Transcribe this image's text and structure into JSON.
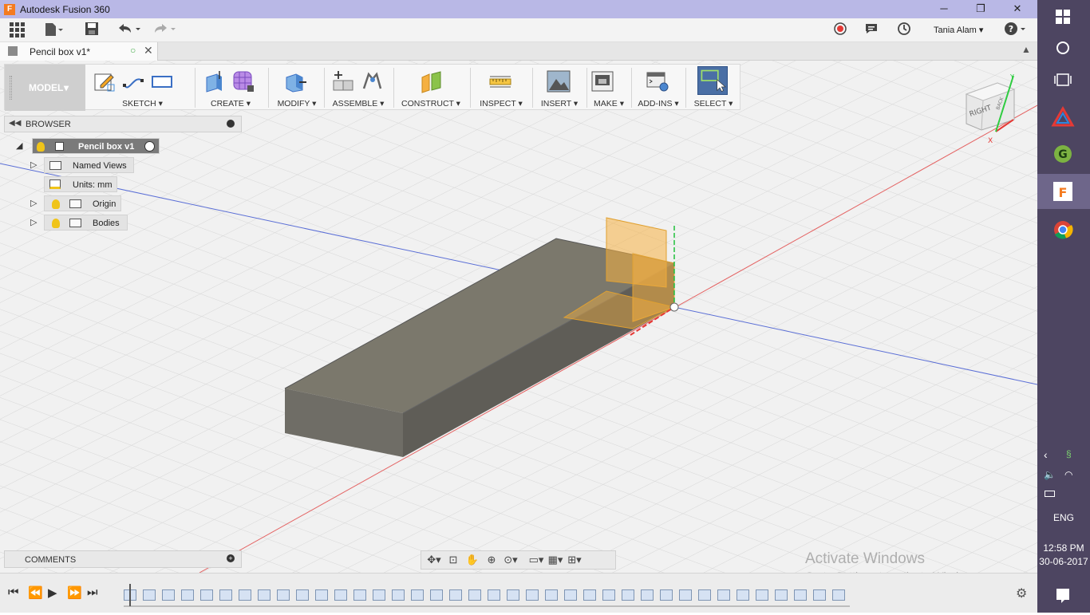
{
  "window": {
    "title": "Autodesk Fusion 360",
    "app_icon_letter": "F"
  },
  "toolbar": {
    "user": "Tania Alam"
  },
  "tab": {
    "name": "Pencil box v1*"
  },
  "ribbon": {
    "workspace": "MODEL",
    "groups": [
      "SKETCH",
      "CREATE",
      "MODIFY",
      "ASSEMBLE",
      "CONSTRUCT",
      "INSPECT",
      "INSERT",
      "MAKE",
      "ADD-INS",
      "SELECT"
    ]
  },
  "browser": {
    "header": "BROWSER",
    "root": "Pencil box v1",
    "items": [
      "Named Views",
      "Units: mm",
      "Origin",
      "Bodies"
    ]
  },
  "comments": {
    "label": "COMMENTS"
  },
  "viewcube": {
    "face_right": "RIGHT",
    "face_back": "BACK",
    "axis_x": "X",
    "axis_y": "Y"
  },
  "watermark": {
    "title": "Activate Windows",
    "subtitle": "Go to Settings to activate Windows."
  },
  "taskbar": {
    "language": "ENG",
    "time": "12:58 PM",
    "date": "30-06-2017"
  },
  "colors": {
    "titlebar": "#b9b8e6",
    "taskbar": "#4d4561",
    "body_fill": "#7a766a",
    "plane_fill": "#f5b041",
    "x_axis": "#e53935",
    "y_axis": "#2e7d32",
    "z_axis": "#3949ab"
  }
}
